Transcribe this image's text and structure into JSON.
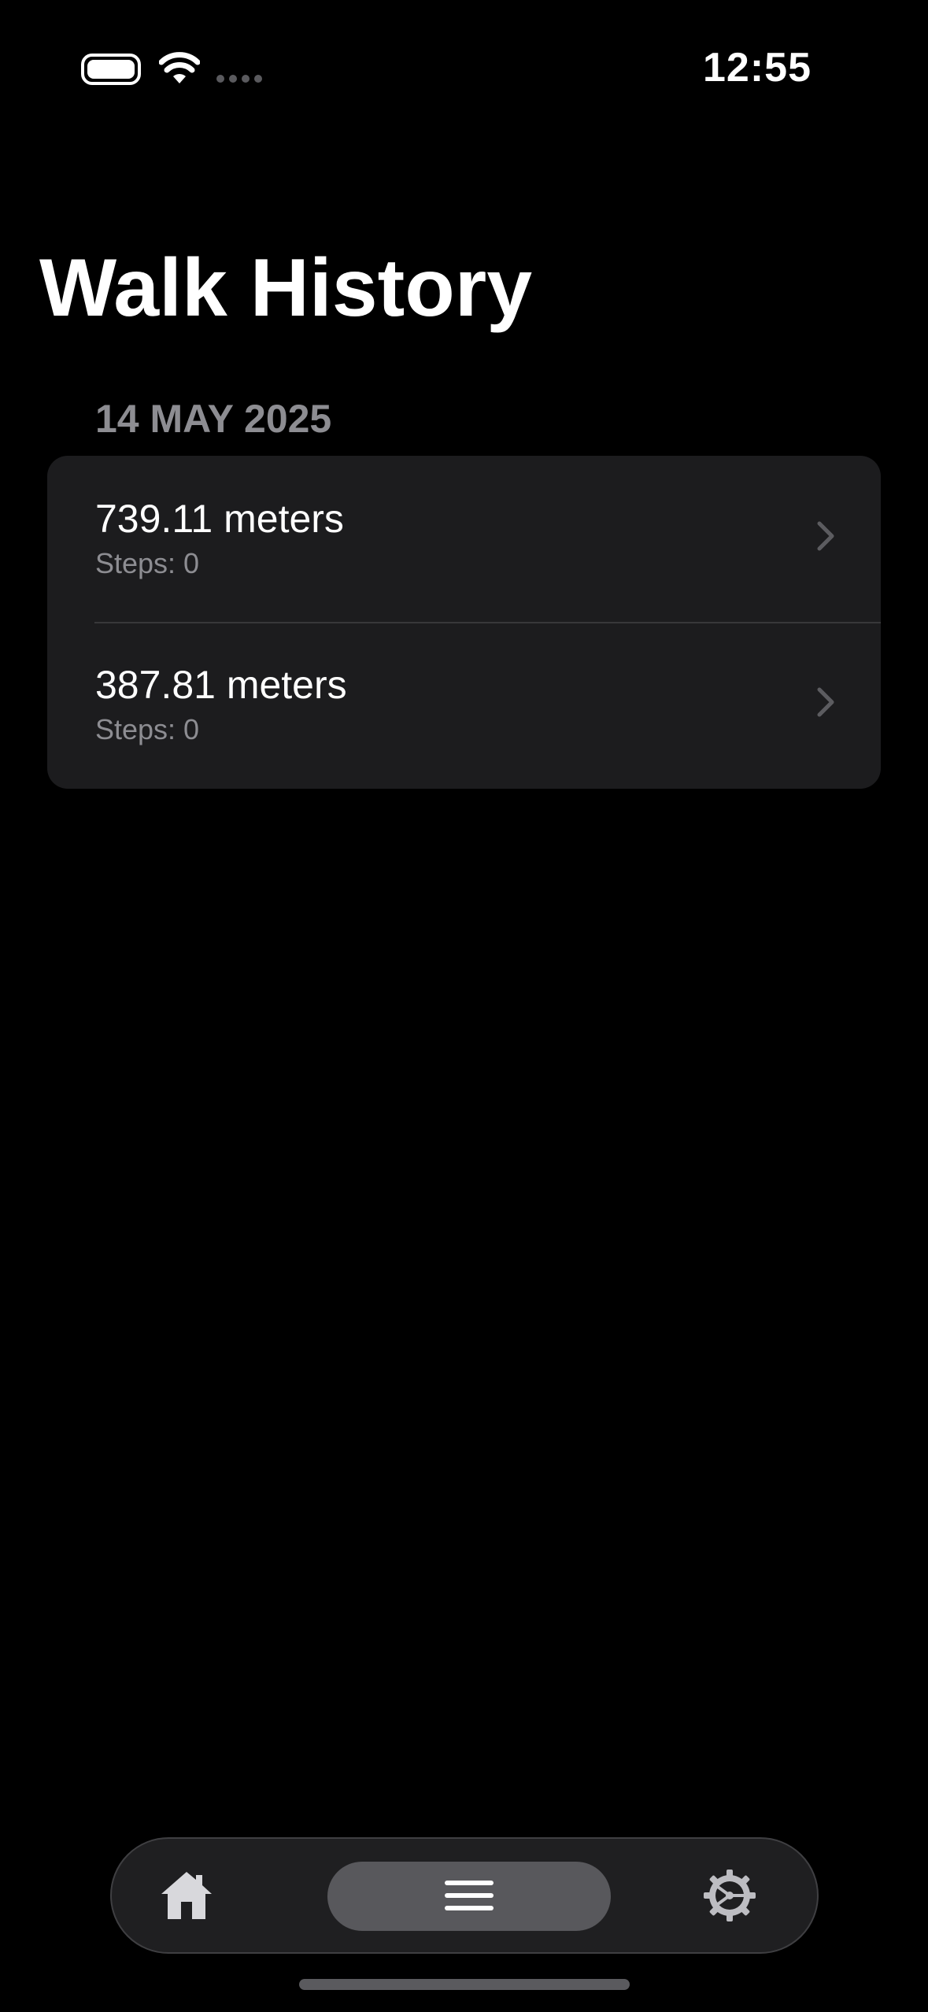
{
  "status_bar": {
    "time": "12:55",
    "icons": [
      "battery-icon",
      "wifi-icon",
      "signal-dots-icon"
    ]
  },
  "page": {
    "title": "Walk History"
  },
  "sections": [
    {
      "header": "14 MAY 2025",
      "rows": [
        {
          "distance": "739.11 meters",
          "steps": "Steps: 0"
        },
        {
          "distance": "387.81 meters",
          "steps": "Steps: 0"
        }
      ]
    }
  ],
  "tab_bar": {
    "tabs": [
      {
        "name": "home",
        "icon": "house-icon",
        "selected": false
      },
      {
        "name": "history",
        "icon": "list-icon",
        "selected": true
      },
      {
        "name": "settings",
        "icon": "gear-icon",
        "selected": false
      }
    ]
  },
  "colors": {
    "background": "#000000",
    "card": "#1c1c1e",
    "secondary_text": "#8d8d92",
    "selected_tab": "#58585c"
  }
}
